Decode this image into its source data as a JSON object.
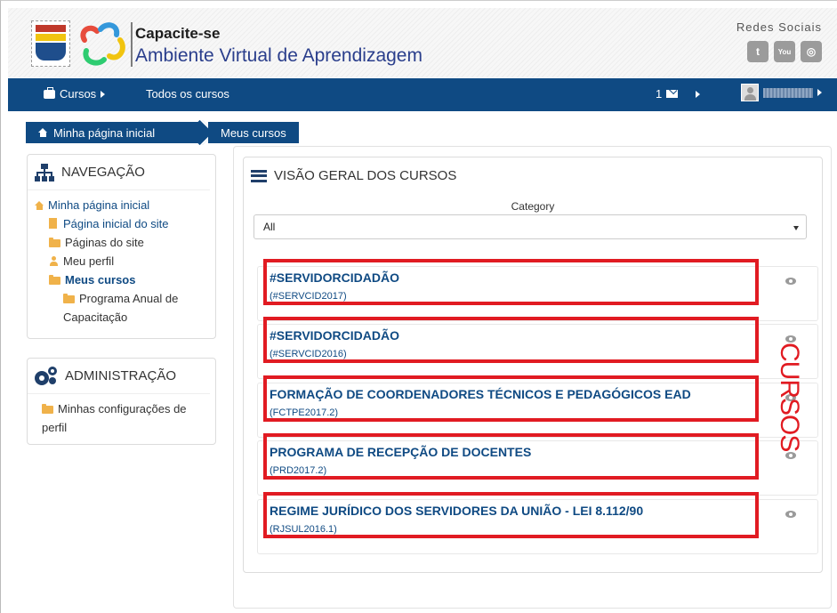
{
  "header": {
    "brand_title": "Capacite-se",
    "brand_subtitle": "Ambiente Virtual de Aprendizagem",
    "social_label": "Redes Sociais",
    "social_icons": [
      "twitter-icon",
      "youtube-icon",
      "other-social-icon"
    ],
    "youtube_glyph": "You",
    "twitter_glyph": "t",
    "other_glyph": "◎"
  },
  "navbar": {
    "courses_label": "Cursos",
    "all_courses_label": "Todos os cursos",
    "messages_count": "1"
  },
  "breadcrumb": {
    "home": "Minha página inicial",
    "current": "Meus cursos"
  },
  "navigation": {
    "title": "NAVEGAÇÃO",
    "items": [
      {
        "label": "Minha página inicial"
      },
      {
        "label": "Página inicial do site"
      },
      {
        "label": "Páginas do site"
      },
      {
        "label": "Meu perfil"
      },
      {
        "label": "Meus cursos"
      },
      {
        "label": "Programa Anual de Capacitação"
      }
    ]
  },
  "administration": {
    "title": "ADMINISTRAÇÃO",
    "items": [
      {
        "label": "Minhas configurações de perfil"
      }
    ]
  },
  "overview": {
    "title": "VISÃO GERAL DOS CURSOS",
    "category_label": "Category",
    "category_value": "All",
    "courses": [
      {
        "title": "#SERVIDORCIDADÃO",
        "code": "(#SERVCID2017)"
      },
      {
        "title": "#SERVIDORCIDADÃO",
        "code": "(#SERVCID2016)"
      },
      {
        "title": "FORMAÇÃO DE COORDENADORES TÉCNICOS E PEDAGÓGICOS EAD",
        "code": "(FCTPE2017.2)"
      },
      {
        "title": "PROGRAMA DE RECEPÇÃO DE DOCENTES",
        "code": "(PRD2017.2)"
      },
      {
        "title": "REGIME JURÍDICO DOS SERVIDORES DA UNIÃO - LEI 8.112/90",
        "code": "(RJSUL2016.1)"
      }
    ]
  },
  "annotation": {
    "text": "CURSOS",
    "color": "#e11b22"
  },
  "colors": {
    "navbar": "#0f4a83",
    "link": "#0f4a83",
    "folder": "#f0b24a",
    "highlight": "#e11b22"
  }
}
